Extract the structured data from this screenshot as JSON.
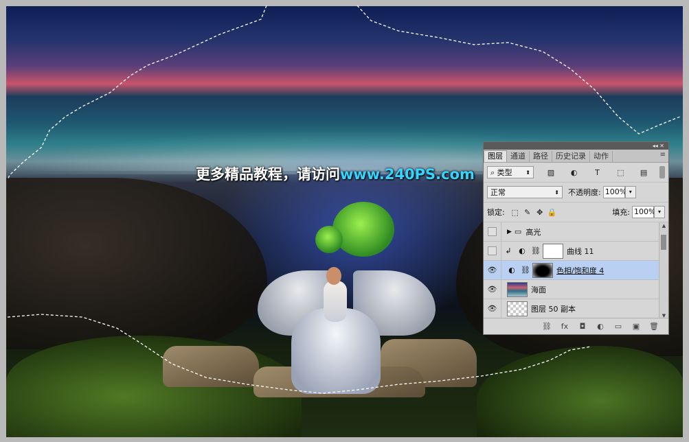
{
  "watermark": {
    "cn": "更多精品教程，请访问",
    "url": "www.240PS.com"
  },
  "panel": {
    "collapse_glyph": "◂◂ ✕",
    "tabs": [
      "图层",
      "通道",
      "路径",
      "历史记录",
      "动作"
    ],
    "menu_icon": "≡",
    "filter": {
      "label": "类型",
      "icon": "search-icon"
    },
    "filter_icons": [
      "image-filter-icon",
      "adjustment-filter-icon",
      "type-filter-icon",
      "shape-filter-icon",
      "smart-object-filter-icon"
    ],
    "blend_mode": "正常",
    "opacity_label": "不透明度:",
    "opacity_value": "100%",
    "lock_label": "锁定:",
    "fill_label": "填充:",
    "fill_value": "100%",
    "layers": [
      {
        "name": "高光",
        "type": "group",
        "visible": false
      },
      {
        "name": "曲线 11",
        "type": "curves",
        "visible": false,
        "clipped": true
      },
      {
        "name": "色相/饱和度 4",
        "type": "hue-saturation",
        "visible": true,
        "selected": true
      },
      {
        "name": "海面",
        "type": "smart-object",
        "visible": true
      },
      {
        "name": "图层 50 副本",
        "type": "pixel",
        "visible": true
      }
    ],
    "bottom_icons": [
      "link-icon",
      "fx-icon",
      "mask-icon",
      "adjustment-icon",
      "folder-icon",
      "new-layer-icon",
      "trash-icon"
    ],
    "bottom_glyphs": [
      "⛓",
      "fx",
      "◘",
      "◐",
      "▭",
      "▣",
      "🗑"
    ]
  }
}
